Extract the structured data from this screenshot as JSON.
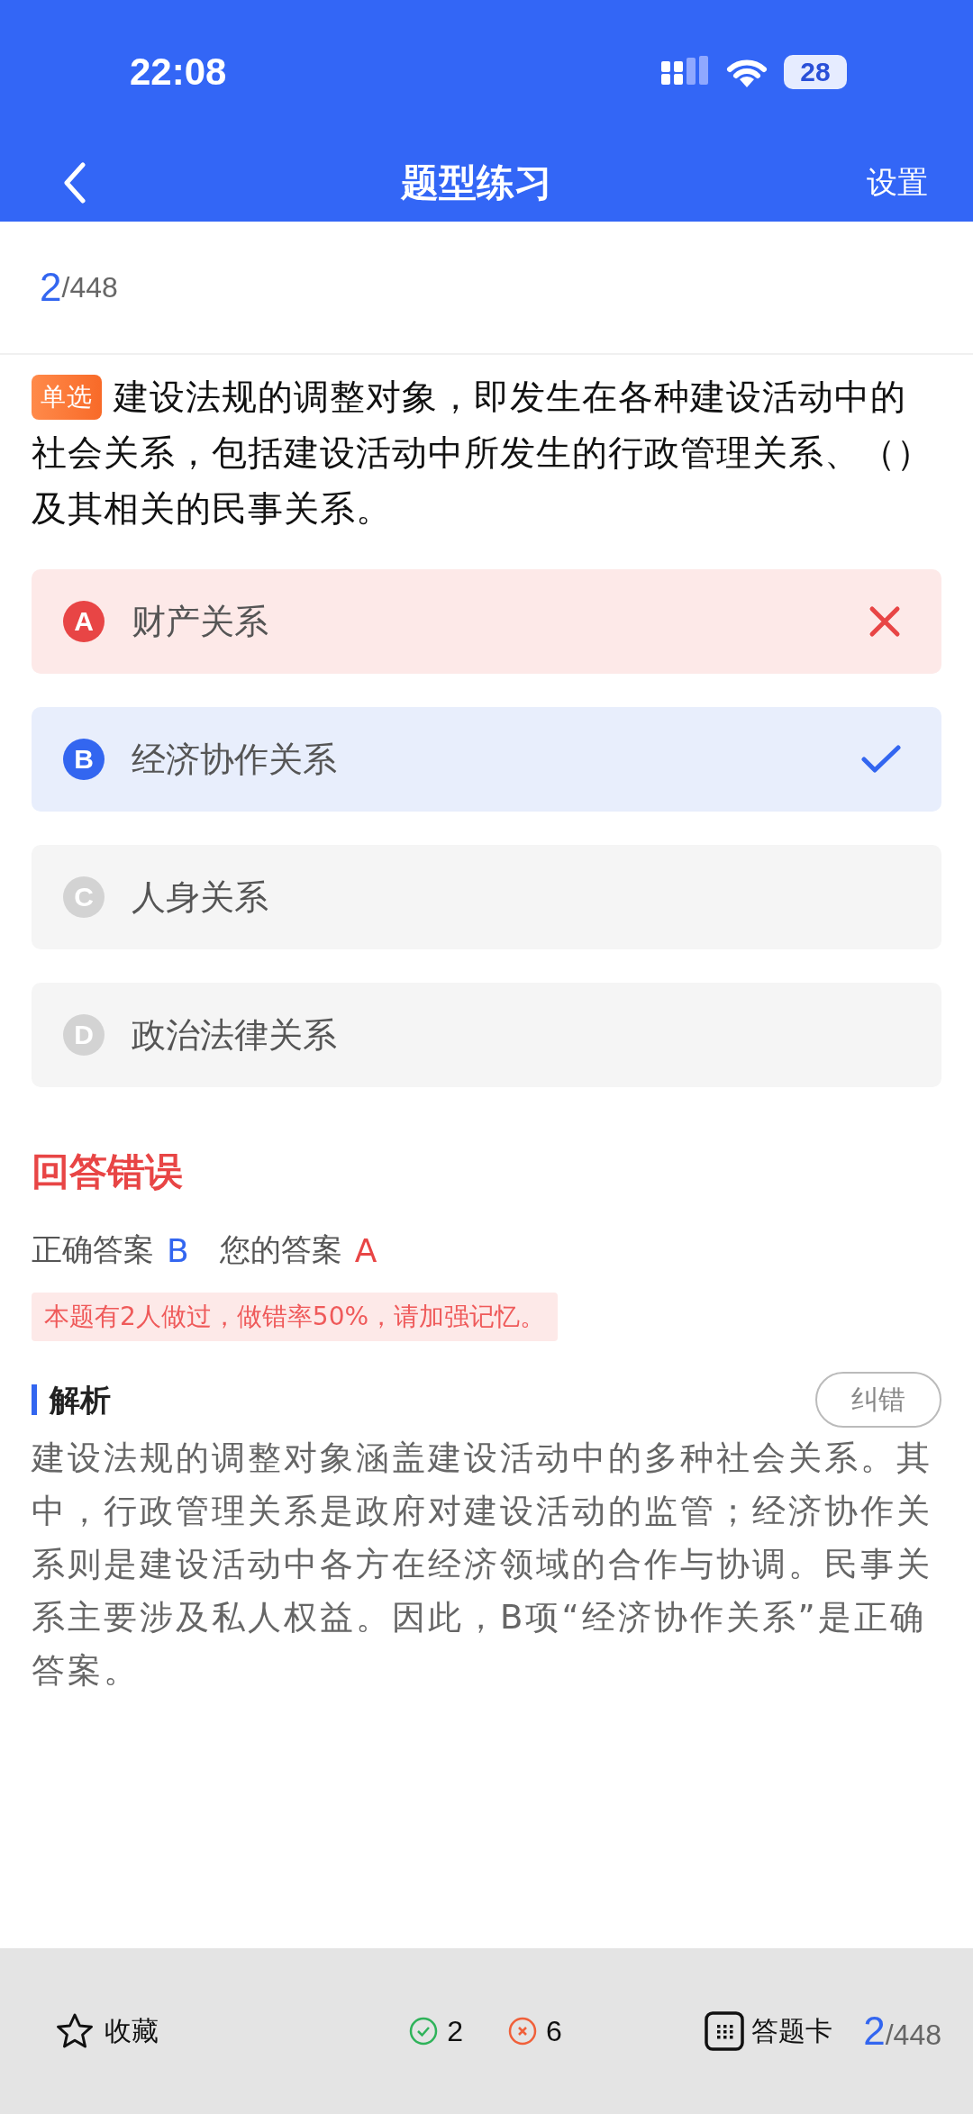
{
  "status_bar": {
    "time": "22:08",
    "battery": "28"
  },
  "header": {
    "title": "题型练习",
    "action": "设置"
  },
  "progress": {
    "current": "2",
    "total": "/448"
  },
  "question": {
    "tag": "单选",
    "text": "建设法规的调整对象，即发生在各种建设活动中的社会关系，包括建设活动中所发生的行政管理关系、（）及其相关的民事关系。"
  },
  "options": [
    {
      "letter": "A",
      "text": "财产关系",
      "kind": "wrong"
    },
    {
      "letter": "B",
      "text": "经济协作关系",
      "kind": "correct"
    },
    {
      "letter": "C",
      "text": "人身关系",
      "kind": "plain"
    },
    {
      "letter": "D",
      "text": "政治法律关系",
      "kind": "plain"
    }
  ],
  "result": {
    "title": "回答错误",
    "correct_label": "正确答案",
    "correct_value": "B",
    "mine_label": "您的答案",
    "mine_value": "A",
    "notice": "本题有2人做过，做错率50%，请加强记忆。"
  },
  "analysis": {
    "title": "解析",
    "report_button": "纠错",
    "text": "建设法规的调整对象涵盖建设活动中的多种社会关系。其中，行政管理关系是政府对建设活动的监管；经济协作关系则是建设活动中各方在经济领域的合作与协调。民事关系主要涉及私人权益。因此，B项“经济协作关系”是正确答案。"
  },
  "bottom_bar": {
    "favorite": "收藏",
    "right_count": "2",
    "wrong_count": "6",
    "card": "答题卡",
    "current": "2",
    "total": "/448"
  }
}
